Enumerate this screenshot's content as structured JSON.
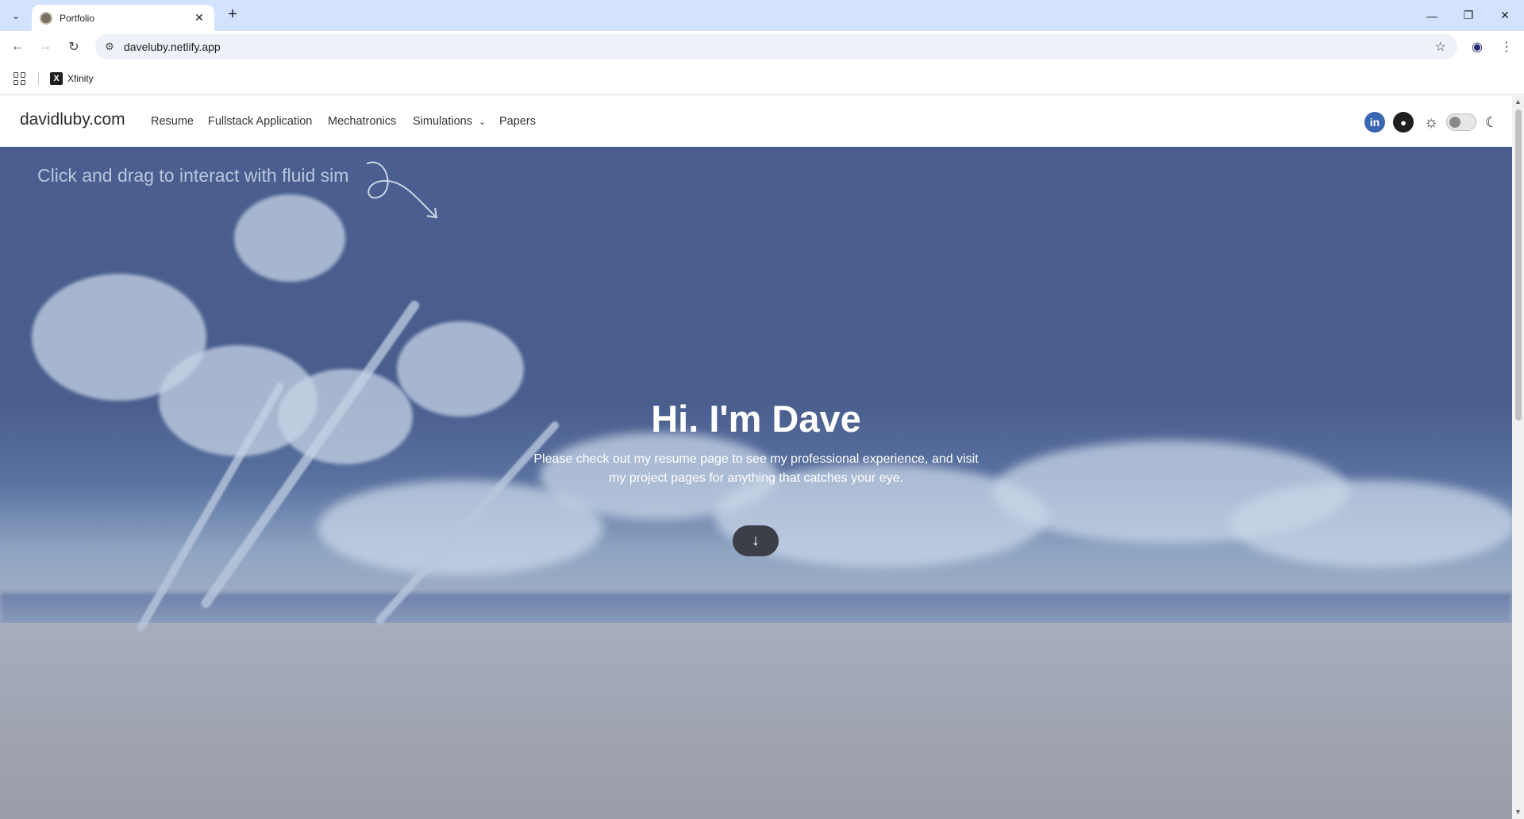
{
  "browser": {
    "tab_title": "Portfolio",
    "new_tab_symbol": "+",
    "url": "daveluby.netlify.app",
    "bookmarks": [
      {
        "label": "Xfinity"
      }
    ]
  },
  "site": {
    "brand": "davidluby.com",
    "nav": {
      "resume": "Resume",
      "fullstack": "Fullstack Application",
      "mechatronics": "Mechatronics",
      "simulations": "Simulations",
      "papers": "Papers"
    },
    "social": {
      "linkedin": "in"
    },
    "hero": {
      "hint": "Click and drag to interact with fluid sim",
      "headline": "Hi. I'm Dave",
      "subtitle": "Please check out my resume page to see my professional experience, and visit my project pages for anything that catches your eye."
    },
    "colors": {
      "linkedin": "#3a65b0",
      "hero_sky": "#4a5f8f",
      "down_button": "#3c3f47"
    }
  }
}
